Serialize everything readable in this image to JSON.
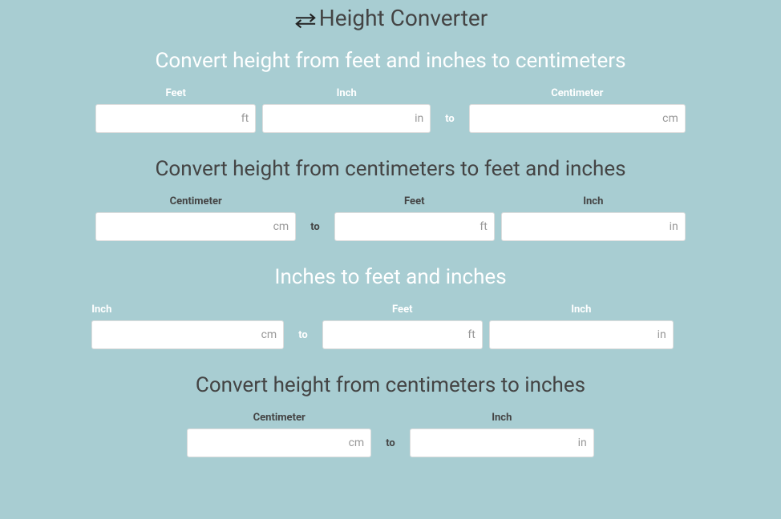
{
  "header": {
    "title": "Height Converter"
  },
  "sections": {
    "ftInToCm": {
      "title": "Convert height from feet and inches to centimeters",
      "labels": {
        "feet": "Feet",
        "inch": "Inch",
        "centimeter": "Centimeter"
      },
      "units": {
        "ft": "ft",
        "in": "in",
        "cm": "cm"
      },
      "to": "to"
    },
    "cmToFtIn": {
      "title": "Convert height from centimeters to feet and inches",
      "labels": {
        "centimeter": "Centimeter",
        "feet": "Feet",
        "inch": "Inch"
      },
      "units": {
        "cm": "cm",
        "ft": "ft",
        "in": "in"
      },
      "to": "to"
    },
    "inToFtIn": {
      "title": "Inches to feet and inches",
      "labels": {
        "inch_src": "Inch",
        "feet": "Feet",
        "inch": "Inch"
      },
      "units": {
        "src": "cm",
        "ft": "ft",
        "in": "in"
      },
      "to": "to"
    },
    "cmToIn": {
      "title": "Convert height from centimeters to inches",
      "labels": {
        "centimeter": "Centimeter",
        "inch": "Inch"
      },
      "units": {
        "cm": "cm",
        "in": "in"
      },
      "to": "to"
    }
  }
}
